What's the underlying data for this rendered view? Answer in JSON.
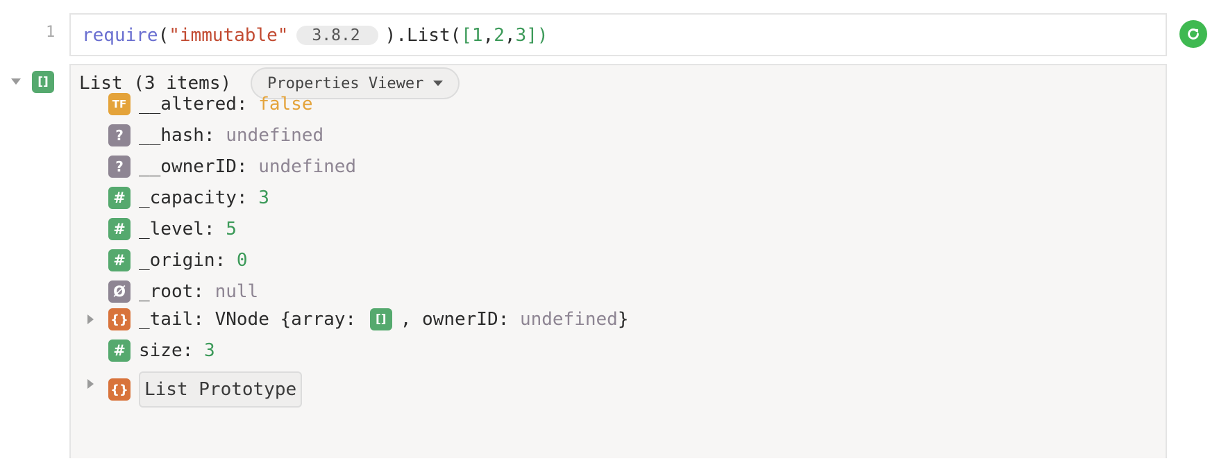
{
  "input": {
    "line_number": "1",
    "code": {
      "fn": "require",
      "open_paren": "(",
      "module": "\"immutable\"",
      "version": "3.8.2",
      "after_version": ").List(",
      "open_bracket": "[",
      "n1": "1",
      "comma1": ",",
      "n2": "2",
      "comma2": ",",
      "n3": "3",
      "close_bracket": "]",
      "close_paren": ")"
    },
    "run_icon": "refresh-icon"
  },
  "output": {
    "title": "List (3 items)",
    "viewer_button": "Properties Viewer",
    "root_badge": "[]",
    "properties": [
      {
        "badge": "TF",
        "type": "bool",
        "key": "__altered:",
        "value": "false"
      },
      {
        "badge": "?",
        "type": "undef",
        "key": "__hash:",
        "value": "undefined"
      },
      {
        "badge": "?",
        "type": "undef",
        "key": "__ownerID:",
        "value": "undefined"
      },
      {
        "badge": "#",
        "type": "num",
        "key": "_capacity:",
        "value": "3"
      },
      {
        "badge": "#",
        "type": "num",
        "key": "_level:",
        "value": "5"
      },
      {
        "badge": "#",
        "type": "num",
        "key": "_origin:",
        "value": "0"
      },
      {
        "badge": "Ø",
        "type": "null",
        "key": "_root:",
        "value": "null"
      }
    ],
    "tail": {
      "badge": "{}",
      "key": "_tail:",
      "value_prefix": "VNode {array:",
      "array_badge": "[]",
      "value_mid": ", ownerID:",
      "value_undef": "undefined",
      "value_suffix": "}"
    },
    "size": {
      "badge": "#",
      "key": "size:",
      "value": "3"
    },
    "prototype": {
      "badge": "{}",
      "label": "List Prototype"
    }
  },
  "colors": {
    "green": "#55a96e",
    "orange": "#d8733b",
    "amber": "#e4a33a",
    "gray": "#8e8593",
    "run": "#3fb951"
  }
}
